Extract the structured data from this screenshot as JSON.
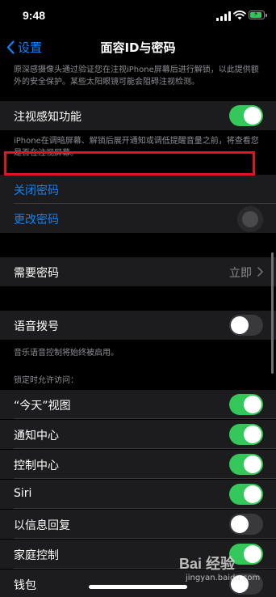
{
  "status_bar": {
    "time": "9:48",
    "battery_color": "#34c759"
  },
  "nav": {
    "back_label": "设置",
    "title": "面容ID与密码"
  },
  "notes": {
    "top": "原深感摄像头通过验证您在注视iPhone屏幕后进行解锁，以此提供额外的安全保护。某些太阳眼镜可能会阻碍注视检测。",
    "attention": "iPhone在调暗屏幕、解锁后展开通知或调低提醒音量之前，将查看您是否在注视屏幕。",
    "voice_dial": "音乐语音控制将始终被启用。",
    "locked_header": "锁定时允许访问："
  },
  "rows": {
    "attention": {
      "label": "注视感知功能",
      "on": true
    },
    "turn_off": {
      "label": "关闭密码"
    },
    "change": {
      "label": "更改密码"
    },
    "require": {
      "label": "需要密码",
      "value": "立即"
    },
    "voice_dial": {
      "label": "语音拨号",
      "on": false
    }
  },
  "locked_items": [
    {
      "label": "“今天”视图",
      "on": true
    },
    {
      "label": "通知中心",
      "on": true
    },
    {
      "label": "控制中心",
      "on": true
    },
    {
      "label": "Siri",
      "on": true
    },
    {
      "label": "以信息回复",
      "on": false
    },
    {
      "label": "家庭控制",
      "on": true
    },
    {
      "label": "钱包",
      "on": false
    }
  ],
  "watermark": {
    "main": "Bai 经验",
    "sub": "jingyan.baidu.com"
  },
  "colors": {
    "accent": "#0a84ff",
    "toggle_on": "#34c759",
    "highlight": "#e1151d"
  }
}
